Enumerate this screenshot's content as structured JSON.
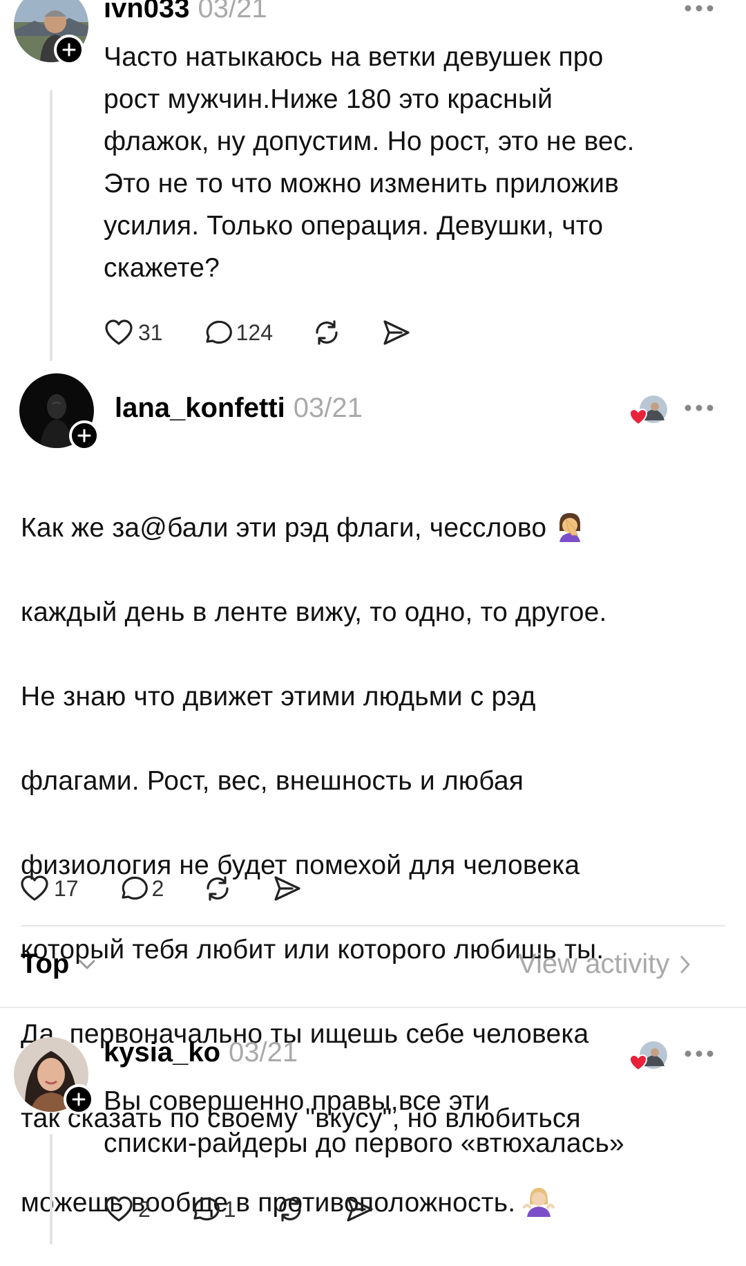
{
  "posts": [
    {
      "username": "ivn033",
      "date": "03/21",
      "text": "Часто натыкаюсь на ветки девушек про\nрост мужчин.Ниже 180 это красный\nфлажок, ну допустим. Но рост, это не вес.\nЭто не то что можно изменить приложив\nусилия. Только операция. Девушки, что\nскажете?",
      "likes": "31",
      "replies": "124"
    },
    {
      "username": "lana_konfetti",
      "date": "03/21",
      "text_lines": [
        "Как же за@бали эти рэд флаги, чесслово",
        "каждый день в ленте вижу, то одно, то другое.",
        "Не знаю что движет этими людьми с рэд",
        "флагами. Рост, вес, внешность и любая",
        "физиология не будет помехой для человека",
        "который тебя любит или которого любишь ты.",
        "Да, первоначально ты ищешь себе человека",
        "так сказать по своему \"вкусу\", но влюбиться",
        "можешь вообще в противоположность."
      ],
      "emoji_1": "facepalm-woman-emoji",
      "emoji_2": "shrug-woman-emoji",
      "likes": "17",
      "replies": "2"
    },
    {
      "username": "kysia_ko",
      "date": "03/21",
      "text": "Вы совершенно правы,все эти\nсписки-райдеры до первого «втюхалась»",
      "likes": "2",
      "replies": "1"
    }
  ],
  "sort": {
    "label": "Top",
    "icon": "chevron-down-icon"
  },
  "activity": {
    "label": "View activity",
    "icon": "chevron-right-icon"
  },
  "colors": {
    "muted": "#a9a9a9",
    "like_heart": "#e8223a",
    "thread_line": "#e3e3e3"
  }
}
